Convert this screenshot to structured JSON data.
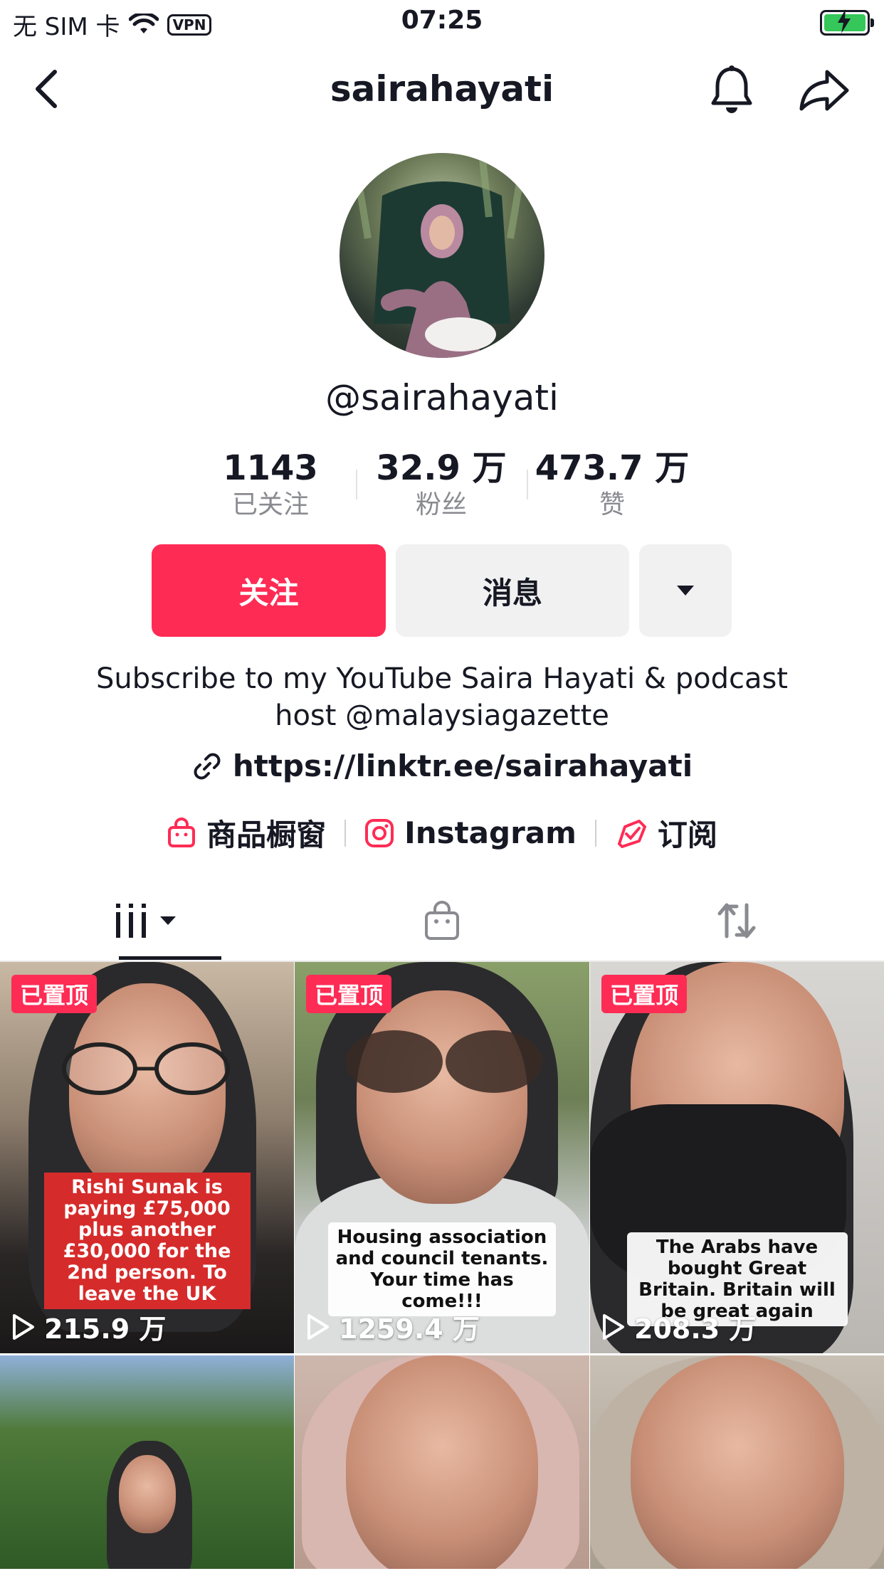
{
  "status_bar": {
    "carrier": "无 SIM 卡",
    "vpn": "VPN",
    "time": "07:25"
  },
  "nav": {
    "title": "sairahayati"
  },
  "profile": {
    "handle": "@sairahayati"
  },
  "stats": [
    {
      "value": "1143",
      "label": "已关注"
    },
    {
      "value": "32.9 万",
      "label": "粉丝"
    },
    {
      "value": "473.7 万",
      "label": "赞"
    }
  ],
  "actions": {
    "follow": "关注",
    "message": "消息"
  },
  "bio": {
    "line1": "Subscribe to my YouTube Saira Hayati & podcast",
    "line2": "host @malaysiagazette",
    "link": "https://linktr.ee/sairahayati"
  },
  "shortcuts": [
    {
      "label": "商品橱窗",
      "icon": "shop-bag-icon"
    },
    {
      "label": "Instagram",
      "icon": "instagram-icon"
    },
    {
      "label": "订阅",
      "icon": "subscribe-icon"
    }
  ],
  "pinned_label": "已置顶",
  "videos": [
    {
      "pinned": true,
      "views": "215.9 万",
      "caption": "Rishi Sunak is paying £75,000 plus another £30,000 for  the 2nd person. To leave the UK"
    },
    {
      "pinned": true,
      "views": "1259.4 万",
      "caption": "Housing association and council tenants. Your time has come!!!"
    },
    {
      "pinned": true,
      "views": "208.3 万",
      "caption": "The Arabs have bought Great Britain. Britain will be great again"
    },
    {
      "pinned": false
    },
    {
      "pinned": false
    },
    {
      "pinned": false
    }
  ],
  "colors": {
    "accent": "#fe2c55",
    "text": "#161823",
    "muted": "#8a8b91",
    "button_bg": "#f1f1f2"
  }
}
